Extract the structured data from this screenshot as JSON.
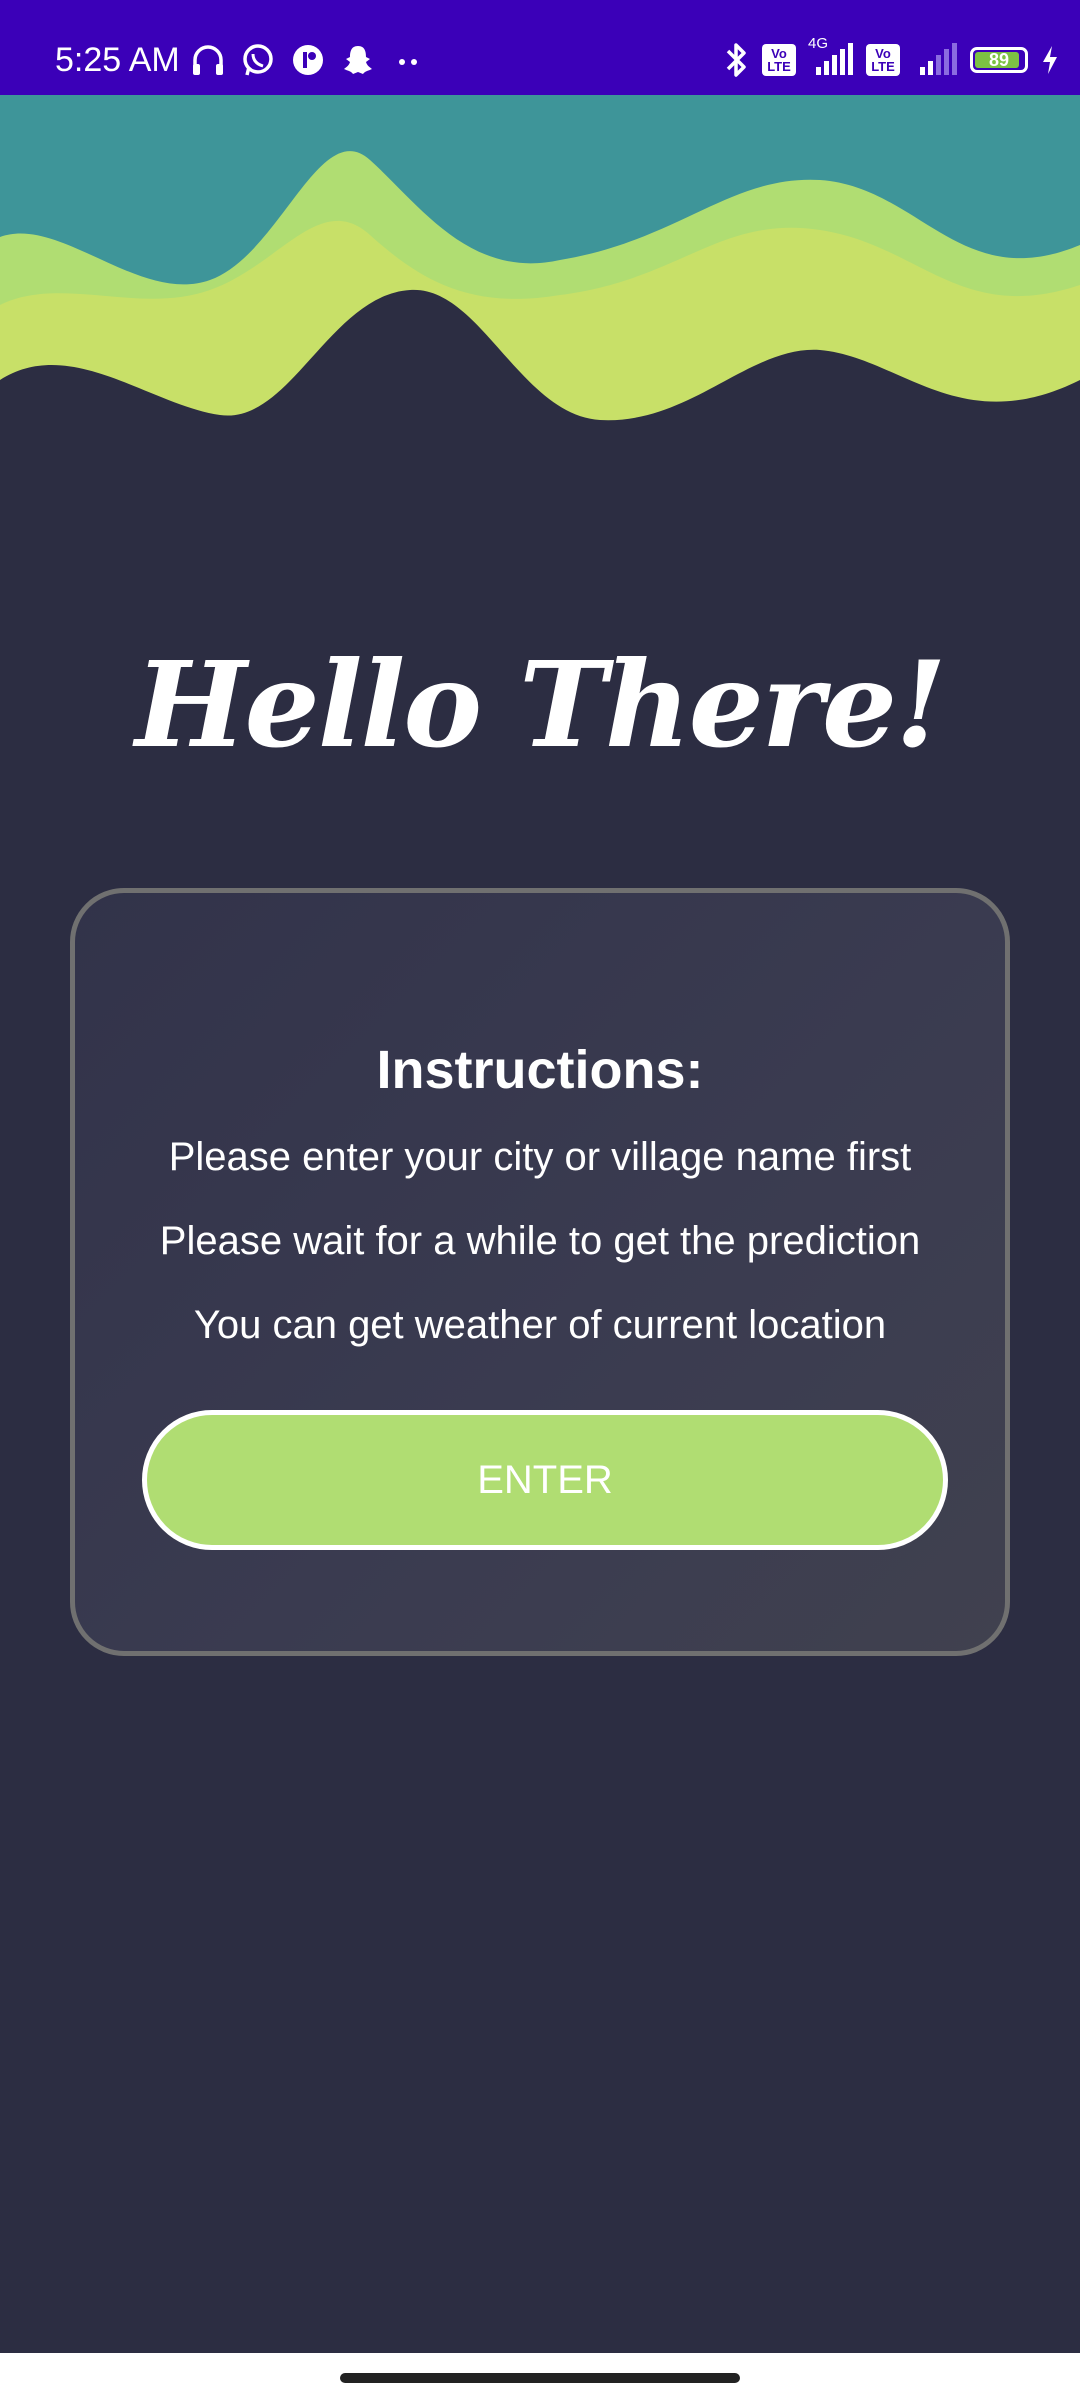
{
  "status_bar": {
    "time": "5:25 AM",
    "left_icons": [
      "headphones-icon",
      "whatsapp-icon",
      "app-icon",
      "snapchat-icon",
      "more-dots-icon"
    ],
    "right_icons": [
      "bluetooth-icon",
      "volte-icon",
      "signal-icon",
      "volte-icon",
      "signal-icon",
      "battery-icon",
      "charging-icon"
    ],
    "volte_label": "Vo LTE",
    "network_label": "4G",
    "battery_level": "89",
    "color": "#3b00b8"
  },
  "header_colors": {
    "teal": "#3e9599",
    "light_green": "#b0dd72",
    "yellow_green": "#c8e068",
    "background": "#2c2d42"
  },
  "greeting": "Hello There!",
  "instructions": {
    "title": "Instructions:",
    "lines": [
      "Please enter your city or village name first",
      "Please wait for a while to get the prediction",
      "You can get weather of current location"
    ],
    "button_label": "ENTER",
    "button_color": "#b0dd72"
  }
}
